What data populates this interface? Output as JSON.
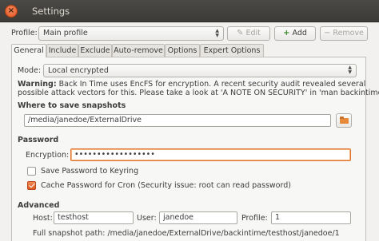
{
  "window": {
    "title": "Settings",
    "close_glyph": "×"
  },
  "profile": {
    "label": "Profile:",
    "selected": "Main profile",
    "edit_label": "Edit",
    "edit_icon": "✎",
    "add_label": "Add",
    "add_icon": "+",
    "remove_label": "Remove",
    "remove_icon": "−"
  },
  "tabs": [
    "General",
    "Include",
    "Exclude",
    "Auto-remove",
    "Options",
    "Expert Options"
  ],
  "active_tab": "General",
  "general": {
    "mode_label": "Mode:",
    "mode_selected": "Local encrypted",
    "warning_bold": "Warning:",
    "warning_line1": "Back In Time uses EncFS for encryption. A recent security audit revealed several",
    "warning_line2": "possible attack vectors for this. Please take a look at 'A NOTE ON SECURITY' in 'man backintime'.",
    "where_heading": "Where to save snapshots",
    "path_value": "/media/janedoe/ExternalDrive",
    "password_heading": "Password",
    "encryption_label": "Encryption:",
    "encryption_value": "••••••••••••••••••",
    "save_password_label": "Save Password to Keyring",
    "save_password_checked": false,
    "cache_password_label": "Cache Password for Cron (Security issue: root can read password)",
    "cache_password_checked": true,
    "advanced_heading": "Advanced",
    "host_label": "Host:",
    "host_value": "testhost",
    "user_label": "User:",
    "user_value": "janedoe",
    "profile_label": "Profile:",
    "profile_value": "1",
    "full_path_label": "Full snapshot path:",
    "full_path_value": "/media/janedoe/ExternalDrive/backintime/testhost/janedoe/1"
  },
  "colors": {
    "accent": "#e1742c",
    "titlebar": "#3c3b37",
    "background": "#f2f1f0"
  }
}
